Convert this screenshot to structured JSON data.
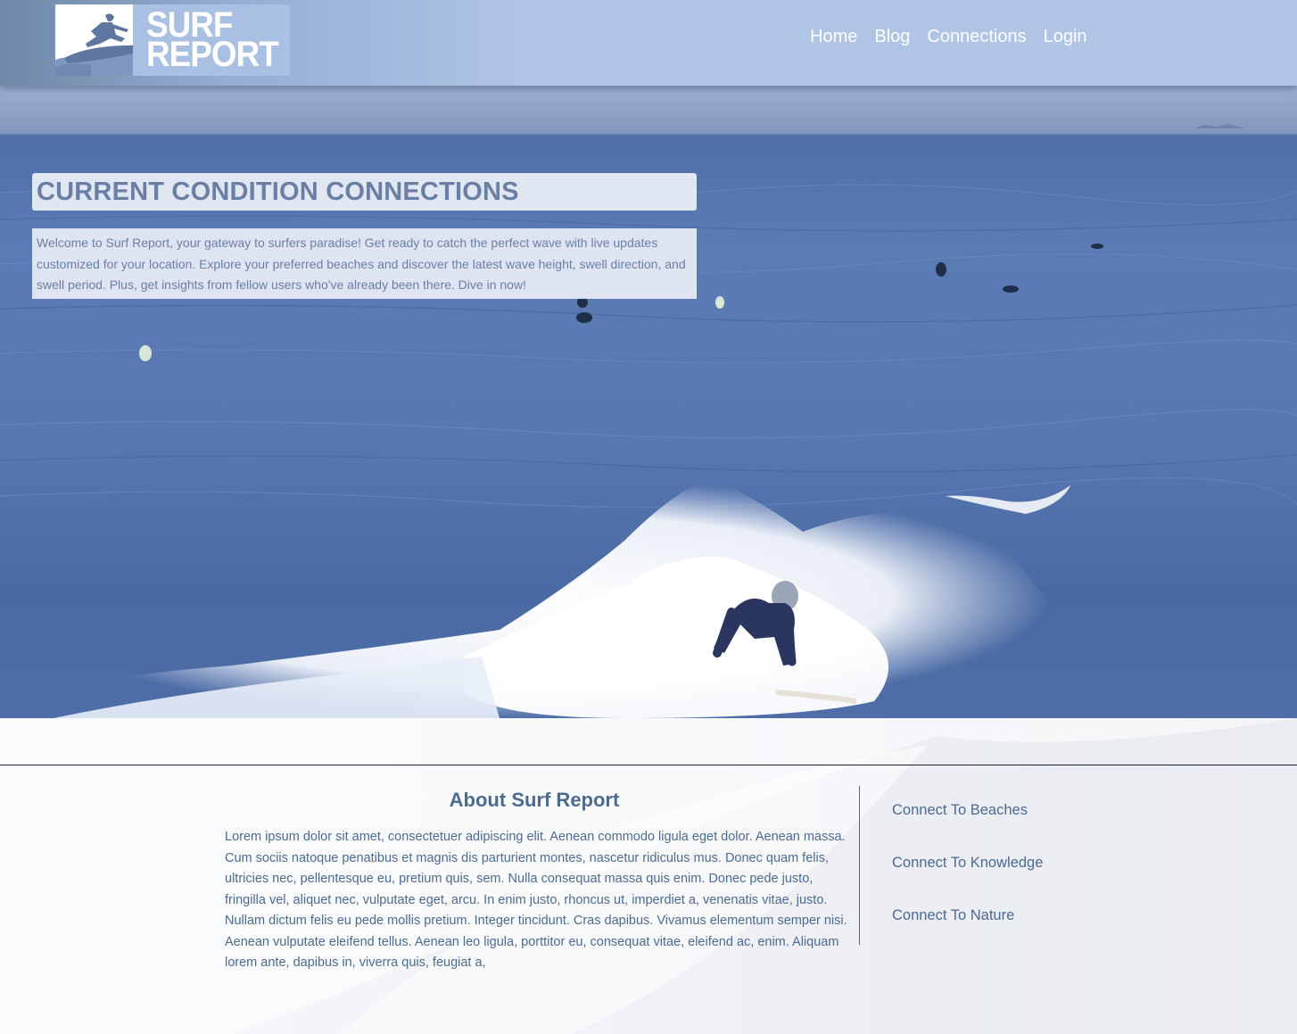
{
  "header": {
    "logo": {
      "line1": "SURF",
      "line2": "REPORT",
      "icon": "surfer-icon"
    },
    "nav": [
      {
        "label": "Home"
      },
      {
        "label": "Blog"
      },
      {
        "label": "Connections"
      },
      {
        "label": "Login"
      }
    ]
  },
  "hero": {
    "title": "CURRENT CONDITION CONNECTIONS",
    "intro": "Welcome to Surf Report, your gateway to surfers paradise! Get ready to catch the perfect wave with live updates customized for your location. Explore your preferred beaches and discover the latest wave height, swell direction, and swell period. Plus, get insights from fellow users who've already been there. Dive in now!",
    "background": "ocean-surfer-video"
  },
  "about": {
    "title": "About Surf Report",
    "text": "Lorem ipsum dolor sit amet, consectetuer adipiscing elit. Aenean commodo ligula eget dolor. Aenean massa. Cum sociis natoque penatibus et magnis dis parturient montes, nascetur ridiculus mus. Donec quam felis, ultricies nec, pellentesque eu, pretium quis, sem. Nulla consequat massa quis enim. Donec pede justo, fringilla vel, aliquet nec, vulputate eget, arcu. In enim justo, rhoncus ut, imperdiet a, venenatis vitae, justo. Nullam dictum felis eu pede mollis pretium. Integer tincidunt. Cras dapibus. Vivamus elementum semper nisi. Aenean vulputate eleifend tellus. Aenean leo ligula, porttitor eu, consequat vitae, eleifend ac, enim. Aliquam lorem ante, dapibus in, viverra quis, feugiat a,"
  },
  "side_links": [
    {
      "label": "Connect To Beaches"
    },
    {
      "label": "Connect To Knowledge"
    },
    {
      "label": "Connect To Nature"
    }
  ],
  "colors": {
    "header_bg": "#afc4e6",
    "text_accent": "#4d6a8f",
    "hero_text": "#6b7fa4"
  }
}
